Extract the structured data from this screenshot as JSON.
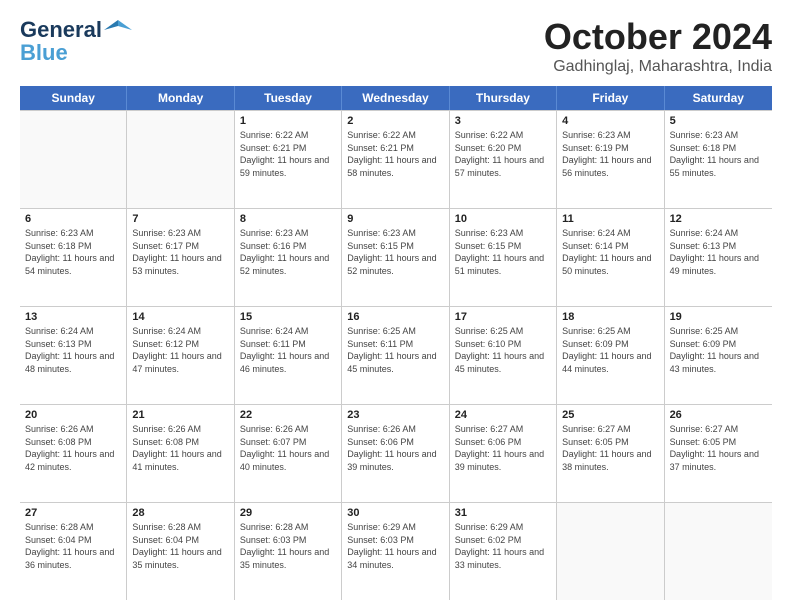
{
  "title": "October 2024",
  "subtitle": "Gadhinglaj, Maharashtra, India",
  "logo": {
    "line1": "General",
    "line2": "Blue"
  },
  "days": [
    "Sunday",
    "Monday",
    "Tuesday",
    "Wednesday",
    "Thursday",
    "Friday",
    "Saturday"
  ],
  "weeks": [
    [
      {
        "day": "",
        "sun": "",
        "set": "",
        "day_hours": ""
      },
      {
        "day": "",
        "sun": "",
        "set": "",
        "day_hours": ""
      },
      {
        "day": "1",
        "sun": "Sunrise: 6:22 AM",
        "set": "Sunset: 6:21 PM",
        "day_hours": "Daylight: 11 hours and 59 minutes."
      },
      {
        "day": "2",
        "sun": "Sunrise: 6:22 AM",
        "set": "Sunset: 6:21 PM",
        "day_hours": "Daylight: 11 hours and 58 minutes."
      },
      {
        "day": "3",
        "sun": "Sunrise: 6:22 AM",
        "set": "Sunset: 6:20 PM",
        "day_hours": "Daylight: 11 hours and 57 minutes."
      },
      {
        "day": "4",
        "sun": "Sunrise: 6:23 AM",
        "set": "Sunset: 6:19 PM",
        "day_hours": "Daylight: 11 hours and 56 minutes."
      },
      {
        "day": "5",
        "sun": "Sunrise: 6:23 AM",
        "set": "Sunset: 6:18 PM",
        "day_hours": "Daylight: 11 hours and 55 minutes."
      }
    ],
    [
      {
        "day": "6",
        "sun": "Sunrise: 6:23 AM",
        "set": "Sunset: 6:18 PM",
        "day_hours": "Daylight: 11 hours and 54 minutes."
      },
      {
        "day": "7",
        "sun": "Sunrise: 6:23 AM",
        "set": "Sunset: 6:17 PM",
        "day_hours": "Daylight: 11 hours and 53 minutes."
      },
      {
        "day": "8",
        "sun": "Sunrise: 6:23 AM",
        "set": "Sunset: 6:16 PM",
        "day_hours": "Daylight: 11 hours and 52 minutes."
      },
      {
        "day": "9",
        "sun": "Sunrise: 6:23 AM",
        "set": "Sunset: 6:15 PM",
        "day_hours": "Daylight: 11 hours and 52 minutes."
      },
      {
        "day": "10",
        "sun": "Sunrise: 6:23 AM",
        "set": "Sunset: 6:15 PM",
        "day_hours": "Daylight: 11 hours and 51 minutes."
      },
      {
        "day": "11",
        "sun": "Sunrise: 6:24 AM",
        "set": "Sunset: 6:14 PM",
        "day_hours": "Daylight: 11 hours and 50 minutes."
      },
      {
        "day": "12",
        "sun": "Sunrise: 6:24 AM",
        "set": "Sunset: 6:13 PM",
        "day_hours": "Daylight: 11 hours and 49 minutes."
      }
    ],
    [
      {
        "day": "13",
        "sun": "Sunrise: 6:24 AM",
        "set": "Sunset: 6:13 PM",
        "day_hours": "Daylight: 11 hours and 48 minutes."
      },
      {
        "day": "14",
        "sun": "Sunrise: 6:24 AM",
        "set": "Sunset: 6:12 PM",
        "day_hours": "Daylight: 11 hours and 47 minutes."
      },
      {
        "day": "15",
        "sun": "Sunrise: 6:24 AM",
        "set": "Sunset: 6:11 PM",
        "day_hours": "Daylight: 11 hours and 46 minutes."
      },
      {
        "day": "16",
        "sun": "Sunrise: 6:25 AM",
        "set": "Sunset: 6:11 PM",
        "day_hours": "Daylight: 11 hours and 45 minutes."
      },
      {
        "day": "17",
        "sun": "Sunrise: 6:25 AM",
        "set": "Sunset: 6:10 PM",
        "day_hours": "Daylight: 11 hours and 45 minutes."
      },
      {
        "day": "18",
        "sun": "Sunrise: 6:25 AM",
        "set": "Sunset: 6:09 PM",
        "day_hours": "Daylight: 11 hours and 44 minutes."
      },
      {
        "day": "19",
        "sun": "Sunrise: 6:25 AM",
        "set": "Sunset: 6:09 PM",
        "day_hours": "Daylight: 11 hours and 43 minutes."
      }
    ],
    [
      {
        "day": "20",
        "sun": "Sunrise: 6:26 AM",
        "set": "Sunset: 6:08 PM",
        "day_hours": "Daylight: 11 hours and 42 minutes."
      },
      {
        "day": "21",
        "sun": "Sunrise: 6:26 AM",
        "set": "Sunset: 6:08 PM",
        "day_hours": "Daylight: 11 hours and 41 minutes."
      },
      {
        "day": "22",
        "sun": "Sunrise: 6:26 AM",
        "set": "Sunset: 6:07 PM",
        "day_hours": "Daylight: 11 hours and 40 minutes."
      },
      {
        "day": "23",
        "sun": "Sunrise: 6:26 AM",
        "set": "Sunset: 6:06 PM",
        "day_hours": "Daylight: 11 hours and 39 minutes."
      },
      {
        "day": "24",
        "sun": "Sunrise: 6:27 AM",
        "set": "Sunset: 6:06 PM",
        "day_hours": "Daylight: 11 hours and 39 minutes."
      },
      {
        "day": "25",
        "sun": "Sunrise: 6:27 AM",
        "set": "Sunset: 6:05 PM",
        "day_hours": "Daylight: 11 hours and 38 minutes."
      },
      {
        "day": "26",
        "sun": "Sunrise: 6:27 AM",
        "set": "Sunset: 6:05 PM",
        "day_hours": "Daylight: 11 hours and 37 minutes."
      }
    ],
    [
      {
        "day": "27",
        "sun": "Sunrise: 6:28 AM",
        "set": "Sunset: 6:04 PM",
        "day_hours": "Daylight: 11 hours and 36 minutes."
      },
      {
        "day": "28",
        "sun": "Sunrise: 6:28 AM",
        "set": "Sunset: 6:04 PM",
        "day_hours": "Daylight: 11 hours and 35 minutes."
      },
      {
        "day": "29",
        "sun": "Sunrise: 6:28 AM",
        "set": "Sunset: 6:03 PM",
        "day_hours": "Daylight: 11 hours and 35 minutes."
      },
      {
        "day": "30",
        "sun": "Sunrise: 6:29 AM",
        "set": "Sunset: 6:03 PM",
        "day_hours": "Daylight: 11 hours and 34 minutes."
      },
      {
        "day": "31",
        "sun": "Sunrise: 6:29 AM",
        "set": "Sunset: 6:02 PM",
        "day_hours": "Daylight: 11 hours and 33 minutes."
      },
      {
        "day": "",
        "sun": "",
        "set": "",
        "day_hours": ""
      },
      {
        "day": "",
        "sun": "",
        "set": "",
        "day_hours": ""
      }
    ]
  ]
}
